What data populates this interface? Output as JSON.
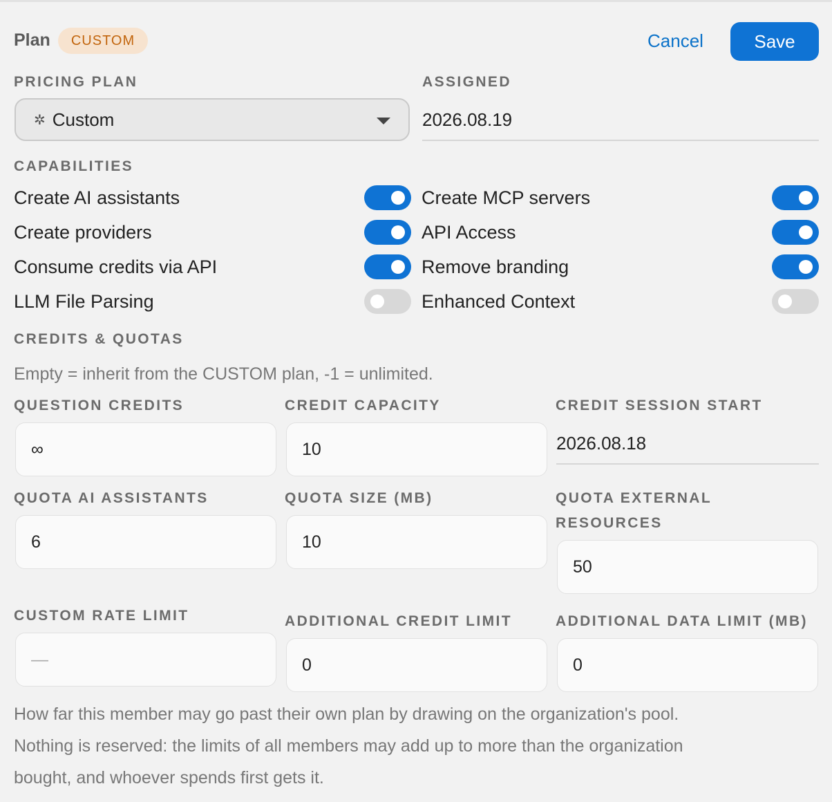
{
  "header": {
    "plan_label": "Plan",
    "plan_badge": "CUSTOM",
    "cancel_label": "Cancel",
    "save_label": "Save"
  },
  "pricing_plan": {
    "label": "PRICING PLAN",
    "value": "Custom",
    "icon": "sparkle-icon"
  },
  "assigned": {
    "label": "ASSIGNED",
    "value": "2026.08.19"
  },
  "capabilities": {
    "label": "CAPABILITIES",
    "left": [
      {
        "label": "Create AI assistants",
        "enabled": true
      },
      {
        "label": "Create providers",
        "enabled": true
      },
      {
        "label": "Consume credits via API",
        "enabled": true
      },
      {
        "label": "LLM File Parsing",
        "enabled": false
      }
    ],
    "right": [
      {
        "label": "Create MCP servers",
        "enabled": true
      },
      {
        "label": "API Access",
        "enabled": true
      },
      {
        "label": "Remove branding",
        "enabled": true
      },
      {
        "label": "Enhanced Context",
        "enabled": false
      }
    ]
  },
  "credits_quotas": {
    "label": "CREDITS & QUOTAS",
    "hint": "Empty = inherit from the CUSTOM plan, -1 = unlimited.",
    "question_credits": {
      "label": "QUESTION CREDITS",
      "value": "∞"
    },
    "credit_capacity": {
      "label": "CREDIT CAPACITY",
      "value": "10"
    },
    "credit_session_start": {
      "label": "CREDIT SESSION START",
      "value": "2026.08.18"
    },
    "quota_ai_assistants": {
      "label": "QUOTA AI ASSISTANTS",
      "value": "6"
    },
    "quota_size": {
      "label": "QUOTA SIZE (MB)",
      "value": "10"
    },
    "quota_external_resources": {
      "label_line1": "QUOTA EXTERNAL",
      "label_line2": "RESOURCES",
      "value": "50"
    },
    "custom_rate_limit": {
      "label": "CUSTOM RATE LIMIT",
      "placeholder": "—"
    },
    "additional_credit_limit": {
      "label": "ADDITIONAL CREDIT LIMIT",
      "value": "0"
    },
    "additional_data_limit": {
      "label": "ADDITIONAL DATA LIMIT (MB)",
      "value": "0"
    }
  },
  "footer": {
    "line1": "How far this member may go past their own plan by drawing on the organization's pool.",
    "line2": "Nothing is reserved: the limits of all members may add up to more than the organization",
    "line3": "bought, and whoever spends first gets it."
  },
  "colors": {
    "accent": "#0f73d4",
    "badge_bg": "#f7e3cf",
    "badge_text": "#c2650d"
  }
}
